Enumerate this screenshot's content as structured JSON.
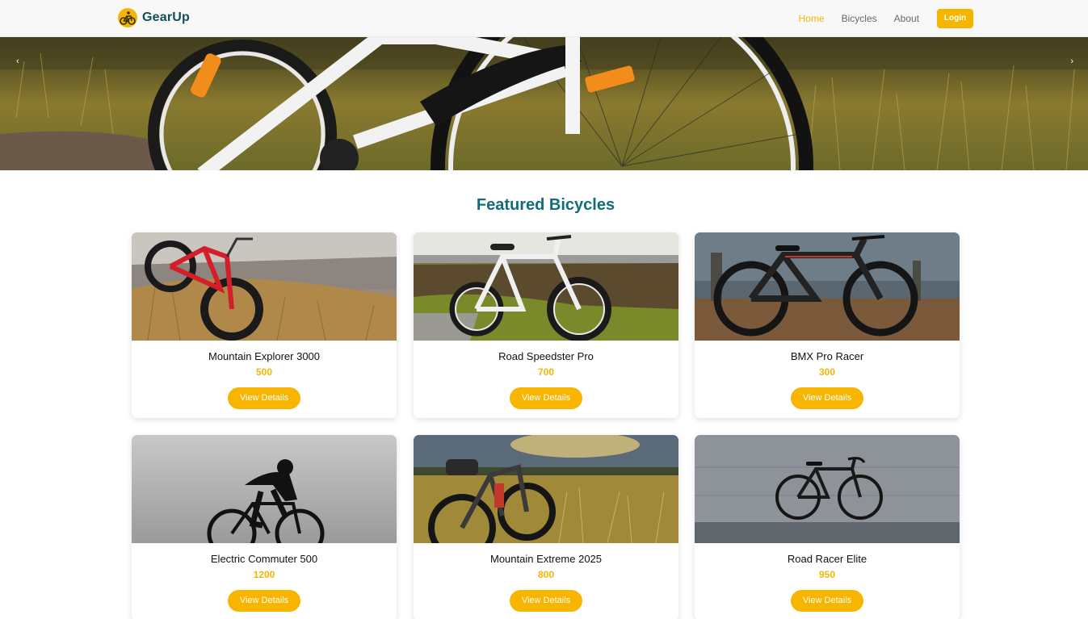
{
  "brand": {
    "name": "GearUp",
    "logo_icon": "bicycle-icon",
    "accent": "#f7b500"
  },
  "nav": {
    "links": [
      {
        "label": "Home",
        "active": true
      },
      {
        "label": "Bicycles",
        "active": false
      },
      {
        "label": "About",
        "active": false
      }
    ],
    "login_label": "Login"
  },
  "hero": {
    "prev_label": "‹",
    "next_label": "›"
  },
  "featured": {
    "title": "Featured Bicycles",
    "button_label": "View Details",
    "items": [
      {
        "name": "Mountain Explorer 3000",
        "price": "500"
      },
      {
        "name": "Road Speedster Pro",
        "price": "700"
      },
      {
        "name": "BMX Pro Racer",
        "price": "300"
      },
      {
        "name": "Electric Commuter 500",
        "price": "1200"
      },
      {
        "name": "Mountain Extreme 2025",
        "price": "800"
      },
      {
        "name": "Road Racer Elite",
        "price": "950"
      }
    ]
  },
  "colors": {
    "title": "#0f6e7a",
    "brand_text": "#0f4f5b",
    "price": "#f2b705",
    "button": "#f7b500"
  }
}
